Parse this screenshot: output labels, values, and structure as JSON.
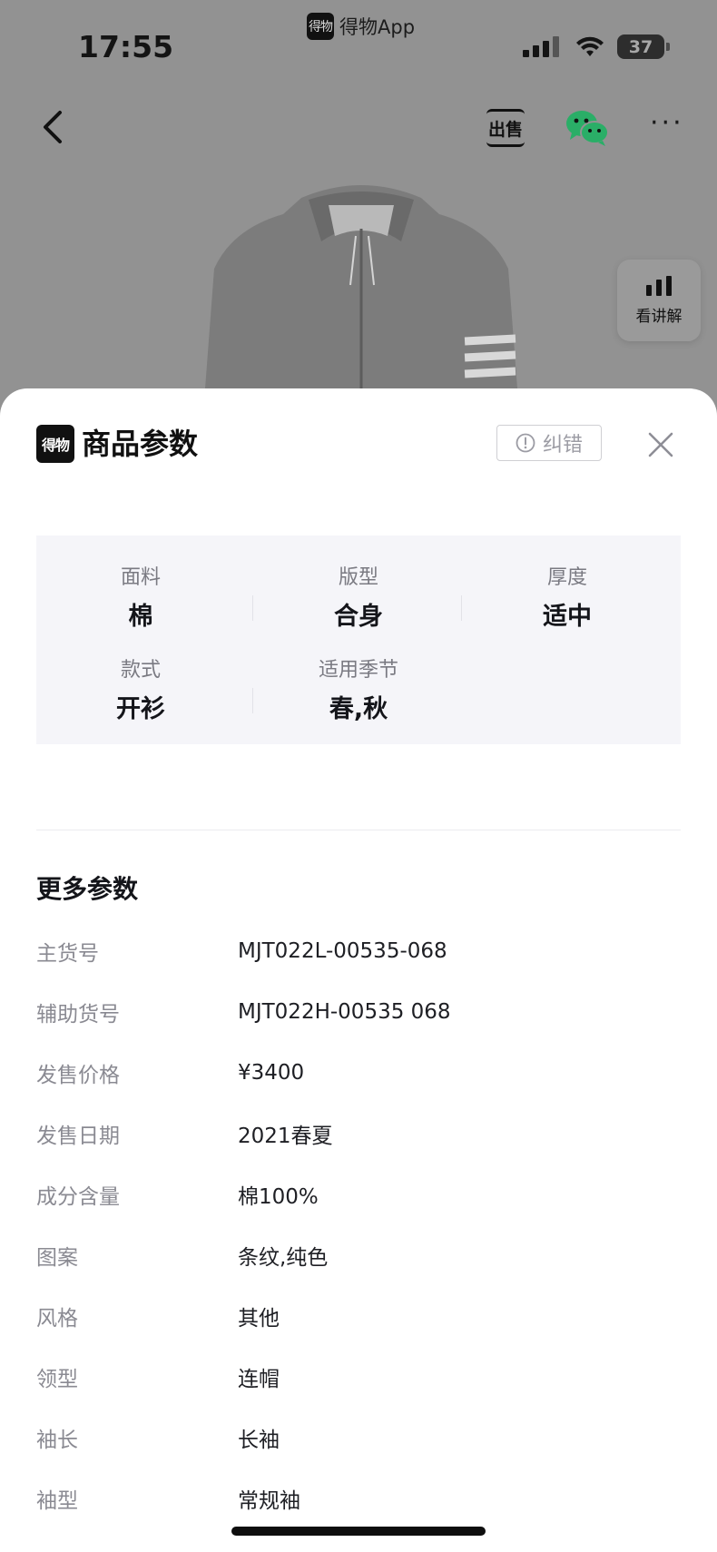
{
  "status_bar": {
    "time": "17:55",
    "source_app": "得物App",
    "source_app_logo": "得物",
    "battery": "37"
  },
  "nav": {
    "sell_label": "出售",
    "more": "···"
  },
  "explain_button": {
    "label": "看讲解"
  },
  "sheet": {
    "logo": "得物",
    "title": "商品参数",
    "report_label": "纠错"
  },
  "key_params": [
    {
      "label": "面料",
      "value": "棉"
    },
    {
      "label": "版型",
      "value": "合身"
    },
    {
      "label": "厚度",
      "value": "适中"
    },
    {
      "label": "款式",
      "value": "开衫"
    },
    {
      "label": "适用季节",
      "value": "春,秋"
    }
  ],
  "more_params": {
    "title": "更多参数",
    "rows": [
      {
        "key": "主货号",
        "value": "MJT022L-00535-068"
      },
      {
        "key": "辅助货号",
        "value": "MJT022H-00535 068"
      },
      {
        "key": "发售价格",
        "value": "¥3400"
      },
      {
        "key": "发售日期",
        "value": "2021春夏"
      },
      {
        "key": "成分含量",
        "value": "棉100%"
      },
      {
        "key": "图案",
        "value": "条纹,纯色"
      },
      {
        "key": "风格",
        "value": "其他"
      },
      {
        "key": "领型",
        "value": "连帽"
      },
      {
        "key": "袖长",
        "value": "长袖"
      },
      {
        "key": "袖型",
        "value": "常规袖"
      }
    ]
  },
  "colors": {
    "overlay": "#929292",
    "sheet_bg": "#ffffff",
    "panel_bg": "#f5f5f9",
    "label_gray": "#8a8a92",
    "text_dark": "#14151a",
    "wechat_green": "#2aae67"
  }
}
